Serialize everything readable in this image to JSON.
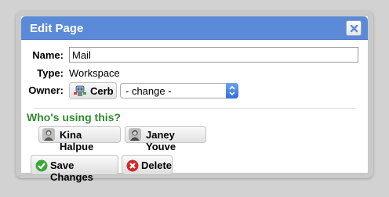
{
  "dialog": {
    "title": "Edit Page",
    "close_icon": "close-icon"
  },
  "form": {
    "name_label": "Name:",
    "name_value": "Mail",
    "type_label": "Type:",
    "type_value": "Workspace",
    "owner_label": "Owner:",
    "owner_name": "Cerb",
    "owner_select": "- change -"
  },
  "watchers": {
    "heading": "Who's using this?",
    "people": [
      "Kina Halpue",
      "Janey Youve"
    ]
  },
  "actions": {
    "save_label": "Save Changes",
    "delete_label": "Delete"
  },
  "colors": {
    "titlebar": "#5b8bd8",
    "heading_green": "#2e8b2e",
    "save_green": "#3aa83a",
    "delete_red": "#d22a2a"
  }
}
